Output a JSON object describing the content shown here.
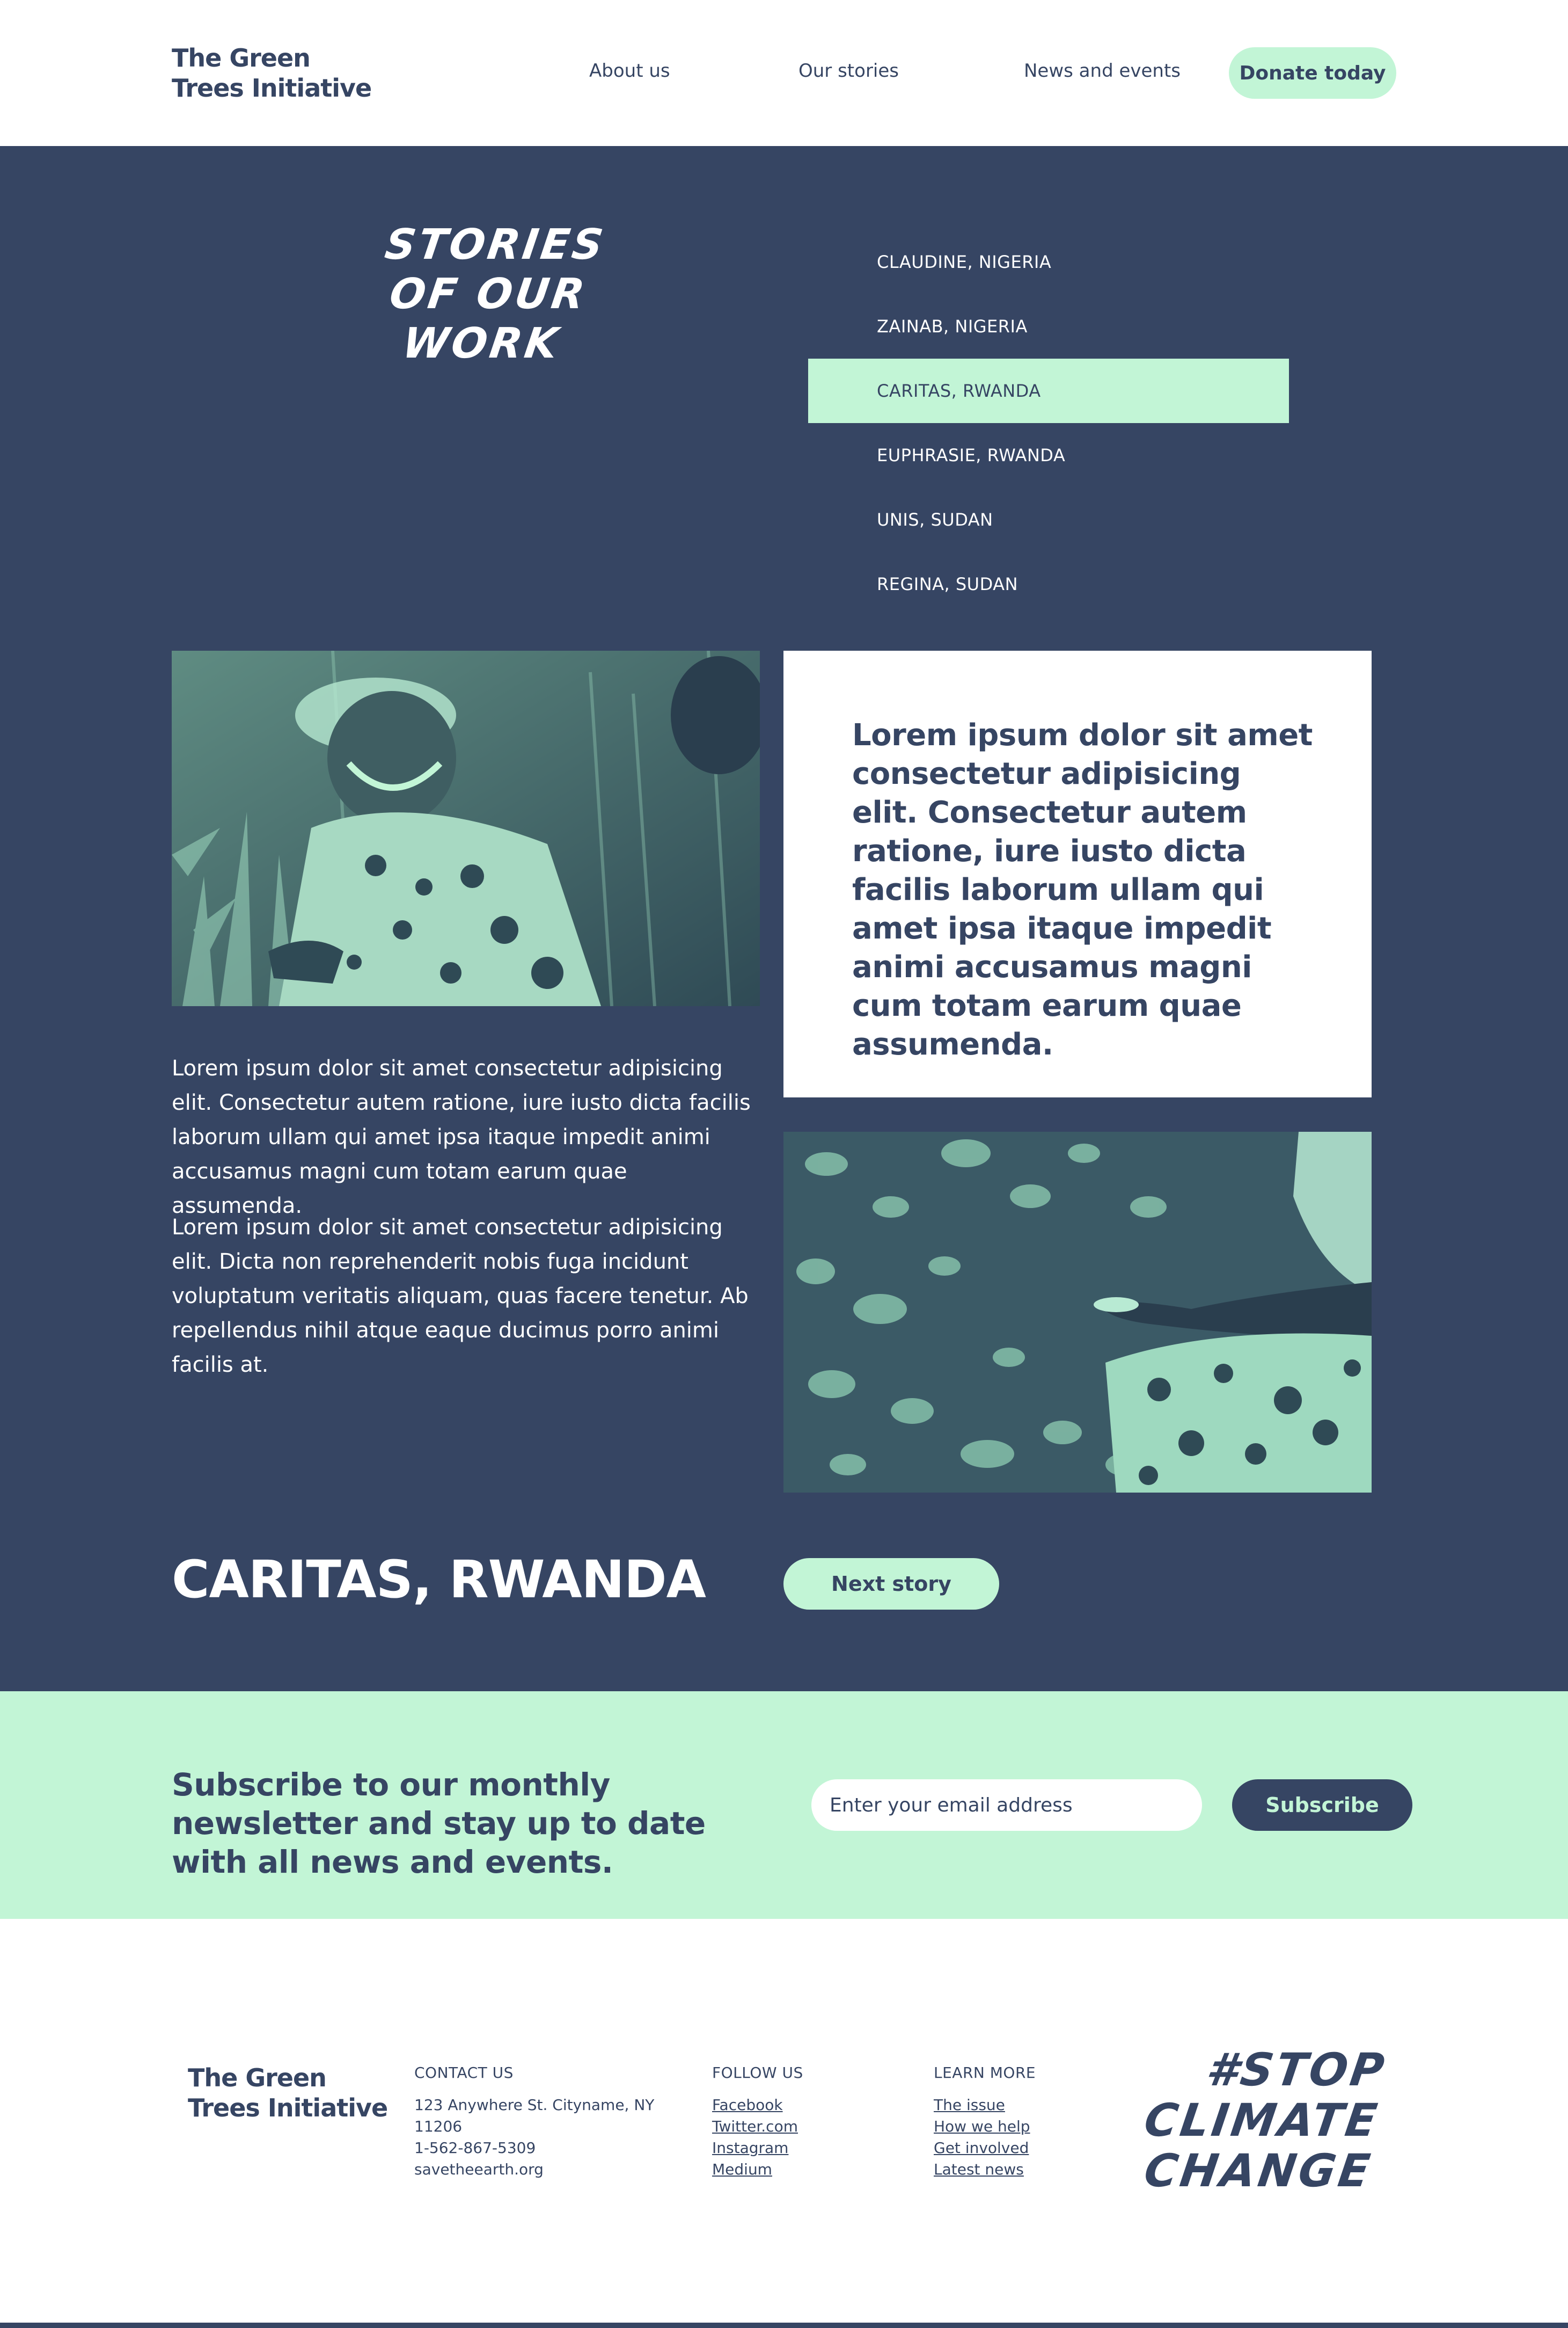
{
  "header": {
    "logo_line1": "The Green",
    "logo_line2": "Trees Initiative",
    "nav": [
      "About us",
      "Our stories",
      "News and events"
    ],
    "donate_label": "Donate today"
  },
  "stories": {
    "title_lines": [
      "STORIES",
      "OF OUR",
      "WORK"
    ],
    "list": [
      {
        "label": "CLAUDINE, NIGERIA",
        "active": false
      },
      {
        "label": "ZAINAB, NIGERIA",
        "active": false
      },
      {
        "label": "CARITAS, RWANDA",
        "active": true
      },
      {
        "label": "EUPHRASIE, RWANDA",
        "active": false
      },
      {
        "label": "UNIS, SUDAN",
        "active": false
      },
      {
        "label": "REGINA, SUDAN",
        "active": false
      }
    ],
    "quote": "Lorem ipsum dolor sit amet consectetur adipisicing elit. Consectetur autem ratione, iure iusto dicta facilis laborum ullam qui amet ipsa itaque impedit animi accusamus magni cum totam earum quae assumenda.",
    "paragraph1": "Lorem ipsum dolor sit amet consectetur adipisicing elit. Consectetur autem ratione, iure iusto dicta facilis laborum ullam qui amet ipsa itaque impedit animi accusamus magni cum totam earum quae assumenda.",
    "paragraph2": "Lorem ipsum dolor sit amet consectetur adipisicing elit. Dicta non reprehenderit nobis fuga incidunt voluptatum veritatis aliquam, quas facere tenetur. Ab repellendus nihil atque eaque ducimus porro animi facilis at.",
    "current_name": "CARITAS, RWANDA",
    "next_label": "Next story"
  },
  "newsletter": {
    "title": "Subscribe to our monthly newsletter and stay up to date with all news and events.",
    "email_placeholder": "Enter your email address",
    "subscribe_label": "Subscribe"
  },
  "footer": {
    "logo_line1": "The Green",
    "logo_line2": "Trees Initiative",
    "contact": {
      "heading": "CONTACT US",
      "lines": [
        "123 Anywhere St. Cityname, NY",
        "11206",
        "1-562-867-5309",
        "savetheearth.org"
      ]
    },
    "follow": {
      "heading": "FOLLOW US",
      "links": [
        "Facebook",
        "Twitter.com",
        "Instagram",
        "Medium"
      ]
    },
    "learn": {
      "heading": "LEARN MORE",
      "links": [
        "The issue",
        "How we help",
        "Get involved",
        "Latest news"
      ]
    },
    "slogan_lines": [
      "#STOP",
      "CLIMATE",
      "CHANGE"
    ]
  },
  "colors": {
    "navy": "#364563",
    "mint": "#c2f5d6",
    "white": "#ffffff"
  }
}
